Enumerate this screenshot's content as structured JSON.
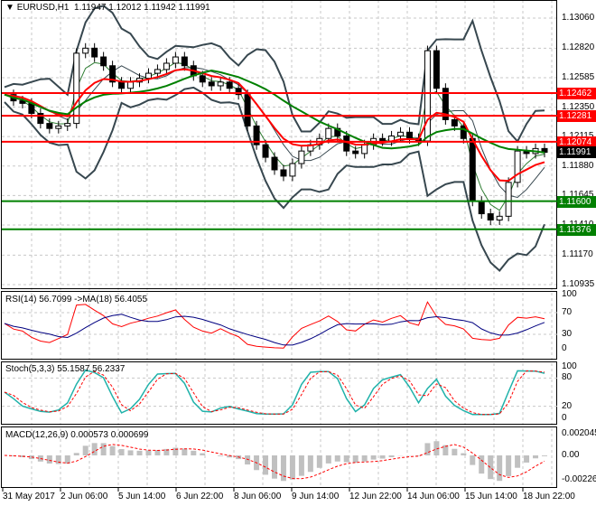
{
  "header": {
    "symbol": "EURUSD,H1",
    "ohlc": "1.11947 1.12012 1.11942 1.11991"
  },
  "price_axis": [
    "1.13060",
    "1.12820",
    "1.12585",
    "1.12350",
    "1.12115",
    "1.11880",
    "1.11645",
    "1.11410",
    "1.11170",
    "1.10935"
  ],
  "levels": [
    {
      "value": "1.12462",
      "color": "#ff0000"
    },
    {
      "value": "1.12281",
      "color": "#ff0000"
    },
    {
      "value": "1.12074",
      "color": "#ff0000"
    },
    {
      "value": "1.11600",
      "color": "#008000"
    },
    {
      "value": "1.11376",
      "color": "#008000"
    }
  ],
  "current_price": "1.11991",
  "close": [
    1.1245,
    1.124,
    1.1238,
    1.123,
    1.1222,
    1.1218,
    1.122,
    1.1222,
    1.1278,
    1.1282,
    1.1275,
    1.1268,
    1.1255,
    1.125,
    1.1255,
    1.1258,
    1.1262,
    1.1265,
    1.127,
    1.1275,
    1.1268,
    1.126,
    1.1255,
    1.1252,
    1.1255,
    1.125,
    1.1245,
    1.122,
    1.1205,
    1.1195,
    1.1185,
    1.118,
    1.119,
    1.12,
    1.1205,
    1.121,
    1.1218,
    1.1212,
    1.12,
    1.1198,
    1.1205,
    1.121,
    1.1208,
    1.1212,
    1.1215,
    1.121,
    1.1208,
    1.128,
    1.125,
    1.1225,
    1.122,
    1.121,
    1.116,
    1.115,
    1.1145,
    1.1148,
    1.1175,
    1.12,
    1.1198,
    1.1202,
    1.1199
  ],
  "rsi": {
    "label": "RSI(14) 56.7099  ->MA(18) 56.4055",
    "axis": [
      "100",
      "70",
      "30",
      "0"
    ]
  },
  "stoch": {
    "label": "Stoch(5,3,3) 55.1587 56.2337",
    "axis": [
      "100",
      "80",
      "20",
      "0"
    ]
  },
  "macd": {
    "label": "MACD(12,26,9) 0.000573 0.000699",
    "axis": [
      "0.002045",
      "0.00",
      "-0.002261"
    ]
  },
  "time_axis": [
    "31 May 2017",
    "2 Jun 06:00",
    "5 Jun 14:00",
    "6 Jun 22:00",
    "8 Jun 06:00",
    "9 Jun 14:00",
    "12 Jun 22:00",
    "14 Jun 06:00",
    "15 Jun 14:00",
    "18 Jun 22:00"
  ],
  "colors": {
    "bull_bear": "#000000",
    "bands": "#37474f",
    "ma_fast": "#ff0000",
    "ma_slow": "#008000",
    "rsi": "#ff0000",
    "rsi_ma": "#000080",
    "stoch_main": "#20b2aa",
    "stoch_signal": "#ff0000",
    "macd_hist": "#c0c0c0",
    "macd_signal": "#ff0000"
  }
}
